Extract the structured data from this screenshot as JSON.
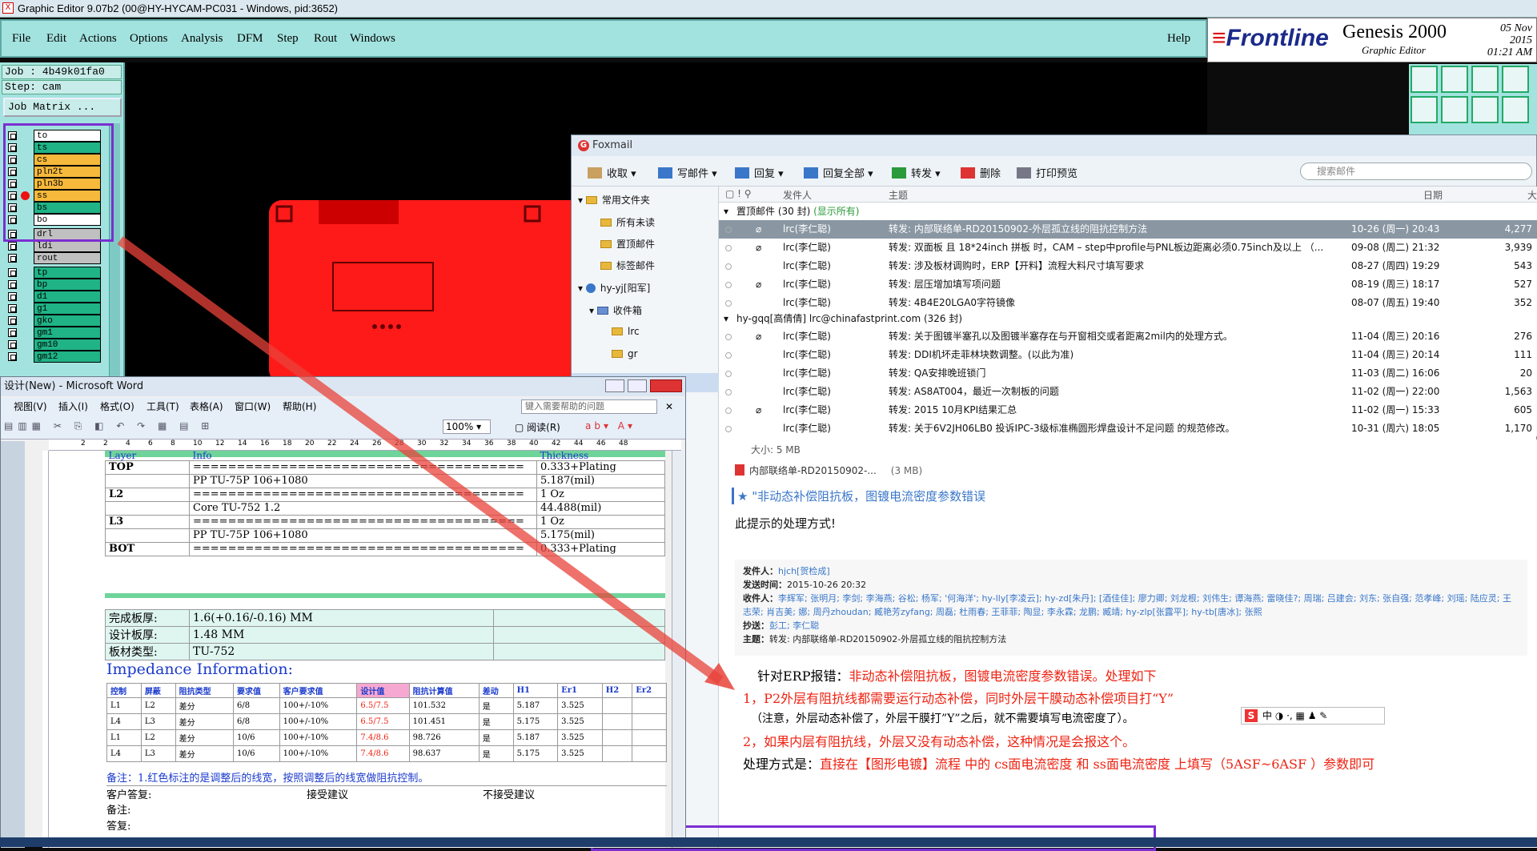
{
  "genesis": {
    "title": "Graphic Editor 9.07b2 (00@HY-HYCAM-PC031 - Windows, pid:3652)",
    "menu": [
      "File",
      "Edit",
      "Actions",
      "Options",
      "Analysis",
      "DFM",
      "Step",
      "Rout",
      "Windows"
    ],
    "help": "Help",
    "brand": {
      "logo": "Frontline",
      "name": "Genesis 2000",
      "sub": "Graphic Editor",
      "date": "05 Nov 2015",
      "time": "01:21 AM"
    },
    "job": "Job : 4b49k01fa0",
    "step": "Step: cam",
    "job_matrix": "Job Matrix ...",
    "layers": [
      {
        "name": "to",
        "color": "#ffffff"
      },
      {
        "name": "ts",
        "color": "#1fb386"
      },
      {
        "name": "cs",
        "color": "#f6b93b"
      },
      {
        "name": "pln2t",
        "color": "#f6b93b"
      },
      {
        "name": "pln3b",
        "color": "#f6b93b"
      },
      {
        "name": "ss",
        "color": "#f6b93b"
      },
      {
        "name": "bs",
        "color": "#1fb386"
      },
      {
        "name": "bo",
        "color": "#ffffff"
      },
      {
        "name": "drl",
        "color": "#c0c0c0"
      },
      {
        "name": "ldi",
        "color": "#c0c0c0"
      },
      {
        "name": "rout",
        "color": "#c0c0c0"
      },
      {
        "name": "tp",
        "color": "#1fb386"
      },
      {
        "name": "bp",
        "color": "#1fb386"
      },
      {
        "name": "d1",
        "color": "#1fb386"
      },
      {
        "name": "g1",
        "color": "#1fb386"
      },
      {
        "name": "gko",
        "color": "#1fb386"
      },
      {
        "name": "gm1",
        "color": "#1fb386"
      },
      {
        "name": "gm10",
        "color": "#1fb386"
      },
      {
        "name": "gm12",
        "color": "#1fb386"
      }
    ]
  },
  "foxmail": {
    "title": "Foxmail",
    "toolbar": [
      "收取",
      "写邮件",
      "回复",
      "回复全部",
      "转发",
      "删除",
      "打印预览"
    ],
    "search_placeholder": "搜索邮件",
    "folders": [
      "常用文件夹",
      "所有未读",
      "置顶邮件",
      "标签邮件",
      "hy-yj[阳军]",
      "收件箱",
      "lrc",
      "gr"
    ],
    "columns": {
      "sender": "发件人",
      "subject": "主题",
      "date": "日期",
      "size": "大"
    },
    "groups": [
      {
        "label": "置顶邮件 (30 封)",
        "extra": "(显示所有)"
      },
      {
        "label": "hy-gqq[高倩倩]  lrc@chinafastprint.com (326 封)",
        "extra": ""
      }
    ],
    "emails": [
      {
        "sender": "lrc(李仁聪)",
        "subject": "转发: 内部联络单-RD20150902-外层孤立线的阻抗控制方法",
        "date": "10-26 (周一) 20:43",
        "size": "4,277"
      },
      {
        "sender": "lrc(李仁聪)",
        "subject": "转发: 双面板 且 18*24inch 拼板 时，CAM – step中profile与PNL板边距离必须0.75inch及以上  （...",
        "date": "09-08 (周二) 21:32",
        "size": "3,939"
      },
      {
        "sender": "lrc(李仁聪)",
        "subject": "转发: 涉及板材调购时，ERP【开料】流程大料尺寸填写要求",
        "date": "08-27 (周四) 19:29",
        "size": "543"
      },
      {
        "sender": "lrc(李仁聪)",
        "subject": "转发: 层压增加填写项问题",
        "date": "08-19 (周三) 18:17",
        "size": "527"
      },
      {
        "sender": "lrc(李仁聪)",
        "subject": "转发: 4B4E20LGA0字符镜像",
        "date": "08-07 (周五) 19:40",
        "size": "352"
      },
      {
        "sender": "lrc(李仁聪)",
        "subject": "转发: 关于图镀半塞孔以及图镀半塞存在与开窗相交或者距离2mil内的处理方式。",
        "date": "11-04 (周三) 20:16",
        "size": "276"
      },
      {
        "sender": "lrc(李仁聪)",
        "subject": "转发: DDI机坏走菲林块数调整。(以此为准)",
        "date": "11-04 (周三) 20:14",
        "size": "111"
      },
      {
        "sender": "lrc(李仁聪)",
        "subject": "转发: QA安排晚班锁门",
        "date": "11-03 (周二) 16:06",
        "size": "20"
      },
      {
        "sender": "lrc(李仁聪)",
        "subject": "转发: AS8AT004，最近一次制板的问题",
        "date": "11-02 (周一) 22:00",
        "size": "1,563"
      },
      {
        "sender": "lrc(李仁聪)",
        "subject": "转发: 2015 10月KPI结果汇总",
        "date": "11-02 (周一) 15:33",
        "size": "605"
      },
      {
        "sender": "lrc(李仁聪)",
        "subject": "转发: 关于6V2JH06LB0  投诉IPC-3级标准椭圆形焊盘设计不足问题 的规范修改。",
        "date": "10-31 (周六) 18:05",
        "size": "1,170"
      }
    ],
    "preview": {
      "size": "大小: 5 MB",
      "attachment": "内部联络单-RD20150902-...",
      "attachment_size": "(3 MB)",
      "heading": "\"非动态补偿阻抗板，图镀电流密度参数错误",
      "intro": "此提示的处理方式!",
      "from_label": "发件人：",
      "from": "hjch[贺检成]",
      "time_label": "发送时间：",
      "time": "2015-10-26 20:32",
      "to_label": "收件人：",
      "to": "李辉军; 张明月; 李剑; 李海燕; 谷松; 杨军; '何海洋'; hy-lly[李凌云]; hy-zd[朱丹]; [酒佳佳]; 廖力卿; 刘龙根; 刘伟生; 谭海燕; 雷晓佳?; 周瑞; 吕建会; 刘东; 张自强; 范孝峰; 刘瑶; 陆应灵; 王志荣; 肖吉美; 娜; 周丹zhoudan; 臧艳芳zyfang; 周磊; 杜雨春; 王菲菲; 陶显; 李永霖; 龙鹏; 臧靖; hy-zlp[张露平]; hy-tb[唐冰]; 张熙",
      "cc_label": "抄送：",
      "cc": "彭工; 李仁聪",
      "subj_label": "主题：",
      "subj": "转发: 内部联络单-RD20150902-外层孤立线的阻抗控制方法",
      "l1a": "针对ERP报错：",
      "l1b": "非动态补偿阻抗板，图镀电流密度参数错误。处理如下",
      "l2": "1，P2外层有阻抗线都需要运行动态补偿，同时外层干膜动态补偿项目打“Y”",
      "l3": "（注意，外层动态补偿了，外层干膜打”Y”之后，就不需要填写电流密度了）。",
      "l4": "2，如果内层有阻抗线，外层又没有动态补偿，这种情况是会报这个。",
      "l5a": "处理方式是：",
      "l5b": "直接在【图形电镀】流程 中的 cs面电流密度 和 ss面电流密度 上填写（5ASF~6ASF ）参数即可",
      "ime": "中"
    }
  },
  "word": {
    "title": "设计(New) - Microsoft Word",
    "menu": [
      "视图(V)",
      "插入(I)",
      "格式(O)",
      "工具(T)",
      "表格(A)",
      "窗口(W)",
      "帮助(H)"
    ],
    "help_placeholder": "键入需要帮助的问题",
    "zoom": "100%",
    "read": "阅读(R)",
    "ruler": [
      "2",
      "2",
      "4",
      "6",
      "8",
      "10",
      "12",
      "14",
      "16",
      "18",
      "20",
      "22",
      "24",
      "26",
      "28",
      "30",
      "32",
      "34",
      "36",
      "38",
      "40",
      "42",
      "44",
      "46",
      "48"
    ],
    "stack_headers": [
      "Layer",
      "Info",
      "Thickness"
    ],
    "stack": [
      [
        "TOP",
        "======================================",
        "0.333+Plating"
      ],
      [
        "",
        "PP     TU-75P     106+1080",
        "5.187(mil)"
      ],
      [
        "L2",
        "======================================",
        "1 Oz"
      ],
      [
        "",
        "Core      TU-752      1.2",
        "44.488(mil)"
      ],
      [
        "L3",
        "======================================",
        "1 Oz"
      ],
      [
        "",
        "PP     TU-75P     106+1080",
        "5.175(mil)"
      ],
      [
        "BOT",
        "======================================",
        "0.333+Plating"
      ]
    ],
    "spec": [
      [
        "完成板厚:",
        "1.6(+0.16/-0.16) MM"
      ],
      [
        "设计板厚:",
        "1.48 MM"
      ],
      [
        "板材类型:",
        "TU-752"
      ]
    ],
    "imp_title": "Impedance Information:",
    "imp_headers": [
      "控制",
      "屏蔽",
      "阻抗类型",
      "要求值",
      "客户要求值",
      "设计值",
      "阻抗计算值",
      "差动",
      "H1",
      "Er1",
      "H2",
      "Er2"
    ],
    "imp_rows": [
      [
        "L1",
        "L2",
        "差分",
        "6/8",
        "100+/-10%",
        "6.5/7.5",
        "101.532",
        "是",
        "5.187",
        "3.525",
        "",
        ""
      ],
      [
        "L4",
        "L3",
        "差分",
        "6/8",
        "100+/-10%",
        "6.5/7.5",
        "101.451",
        "是",
        "5.175",
        "3.525",
        "",
        ""
      ],
      [
        "L1",
        "L2",
        "差分",
        "10/6",
        "100+/-10%",
        "7.4/8.6",
        "98.726",
        "是",
        "5.187",
        "3.525",
        "",
        ""
      ],
      [
        "L4",
        "L3",
        "差分",
        "10/6",
        "100+/-10%",
        "7.4/8.6",
        "98.637",
        "是",
        "5.175",
        "3.525",
        "",
        ""
      ]
    ],
    "note": "备注：1.红色标注的是调整后的线宽，按照调整后的线宽做阻抗控制。",
    "reply_label": "客户答复:",
    "accept": "接受建议",
    "reject": "不接受建议",
    "remark": "备注:",
    "answer": "答复:"
  }
}
